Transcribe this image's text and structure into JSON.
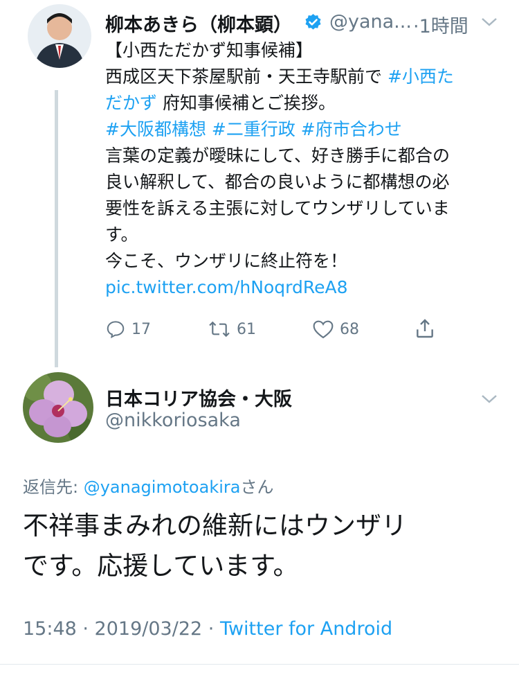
{
  "tweet1": {
    "name": "柳本あきら（柳本顕）",
    "handle": "@yana...",
    "time": "·1時間",
    "text": {
      "line1": "【小西ただかず知事候補】",
      "line2a": "西成区天下茶屋駅前・天王寺駅前で ",
      "line2b": "#小西た",
      "line3a": "だかず",
      "line3b": " 府知事候補とご挨拶。",
      "hashtags": "#大阪都構想 #二重行政 #府市合わせ",
      "line5": "言葉の定義が曖昧にして、好き勝手に都合の",
      "line6": "良い解釈して、都合の良いように都構想の必",
      "line7": "要性を訴える主張に対してウンザリしていま",
      "line8": "す。",
      "line9": "今こそ、ウンザリに終止符を！",
      "link": "pic.twitter.com/hNoqrdReA8"
    },
    "actions": {
      "replies": "17",
      "retweets": "61",
      "likes": "68"
    }
  },
  "tweet2": {
    "name": "日本コリア協会・大阪",
    "handle": "@nikkoriosaka",
    "reply_label": "返信先: ",
    "reply_handle": "@yanagimotoakira",
    "reply_suffix": "さん",
    "line1": "不祥事まみれの維新にはウンザリ",
    "line2": "です。応援しています。",
    "timestamp": "15:48 · 2019/03/22 · ",
    "source": "Twitter for Android"
  },
  "colors": {
    "link": "#1da1f2",
    "muted": "#657786",
    "verified": "#1da1f2"
  }
}
